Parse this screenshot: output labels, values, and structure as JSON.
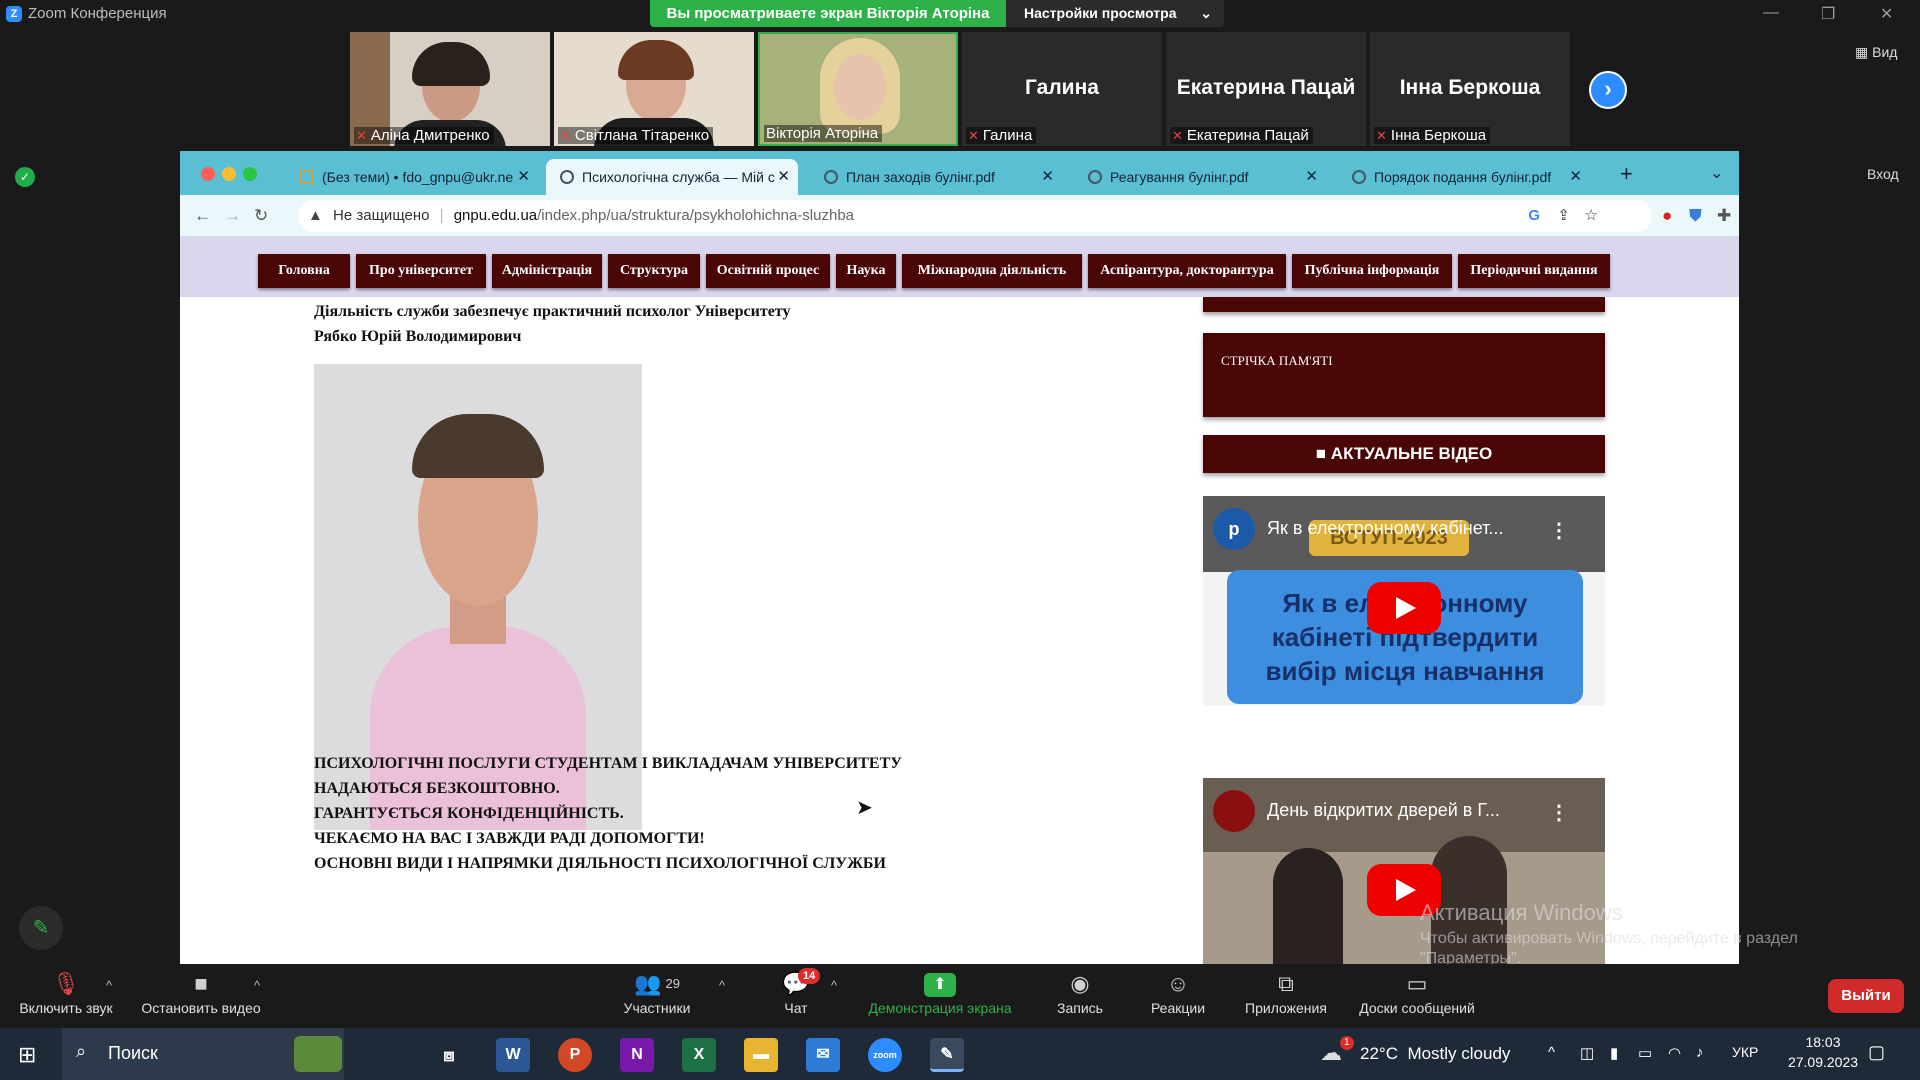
{
  "window": {
    "title": "Zoom Конференция",
    "share_banner": "Вы просматриваете экран Вікторія Аторіна",
    "view_options": "Настройки просмотра"
  },
  "participants": [
    {
      "name": "Аліна Дмитренко",
      "video": true
    },
    {
      "name": "Світлана Тітаренко",
      "video": true
    },
    {
      "name": "Вікторія Аторіна",
      "video": true
    },
    {
      "name": "Галина",
      "display": "Галина",
      "video": false
    },
    {
      "name": "Екатерина Пацай",
      "display": "Екатерина Пацай",
      "video": false
    },
    {
      "name": "Інна Беркоша",
      "display": "Інна Беркоша",
      "video": false
    }
  ],
  "side": {
    "view_label": "Вид",
    "enter_label": "Вход"
  },
  "browser": {
    "tabs": [
      {
        "label": "(Без теми) • fdo_gnpu@ukr.ne"
      },
      {
        "label": "Психологічна служба — Мій с"
      },
      {
        "label": "План заходів булінг.pdf"
      },
      {
        "label": "Реагування булінг.pdf"
      },
      {
        "label": "Порядок подання булінг.pdf"
      }
    ],
    "security": "Не защищено",
    "url_host": "gnpu.edu.ua",
    "url_path": "/index.php/ua/struktura/psykholohichna-sluzhba"
  },
  "site": {
    "nav": [
      "Головна",
      "Про університет",
      "Адміністрація",
      "Структура",
      "Освітній процес",
      "Наука",
      "Міжнародна діяльність",
      "Аспірантура, докторантура",
      "Публічна інформація",
      "Періодичні видання"
    ],
    "intro_line1": "Діяльність служби забезпечує практичний психолог Університету",
    "intro_line2": "Рябко Юрій Володимирович",
    "body_lines": [
      "ПСИХОЛОГІЧНІ ПОСЛУГИ СТУДЕНТАМ І ВИКЛАДАЧАМ УНІВЕРСИТЕТУ",
      "НАДАЮТЬСЯ БЕЗКОШТОВНО.",
      "ГАРАНТУЄТЬСЯ КОНФІДЕНЦІЙНІСТЬ.",
      "ЧЕКАЄМО НА ВАС І ЗАВЖДИ РАДІ ДОПОМОГТИ!",
      "ОСНОВНІ ВИДИ І НАПРЯМКИ ДІЯЛЬНОСТІ ПСИХОЛОГІЧНОЇ СЛУЖБИ"
    ],
    "sidebar_memory": "СТРІЧКА ПАМ'ЯТІ",
    "sidebar_video": "АКТУАЛЬНЕ ВІДЕО",
    "video1_title": "Як в електронному кабінет...",
    "video1_thumb_top": "ВСТУП-2023",
    "video1_thumb_lines": [
      "Як в електронному",
      "кабінеті підтвердити",
      "вибір місця навчання"
    ],
    "video2_title": "День відкритих дверей в Г..."
  },
  "watermark": {
    "title": "Активация Windows",
    "line1": "Чтобы активировать Windows, перейдите в раздел",
    "line2": "\"Параметры\"."
  },
  "zoombar": {
    "mute": "Включить звук",
    "video": "Остановить видео",
    "participants": "Участники",
    "participants_count": "29",
    "chat": "Чат",
    "chat_badge": "14",
    "share": "Демонстрация экрана",
    "record": "Запись",
    "reactions": "Реакции",
    "apps": "Приложения",
    "whiteboards": "Доски сообщений",
    "leave": "Выйти"
  },
  "taskbar": {
    "search": "Поиск",
    "weather_temp": "22°C",
    "weather_text": "Mostly cloudy",
    "weather_badge": "1",
    "lang": "УКР",
    "time": "18:03",
    "date": "27.09.2023"
  },
  "colors": {
    "share_green": "#2fb14a",
    "zoom_blue": "#2d8cff",
    "site_maroon": "#4a0505",
    "tab_teal": "#5bbfd4",
    "leave_red": "#d02b2b"
  }
}
